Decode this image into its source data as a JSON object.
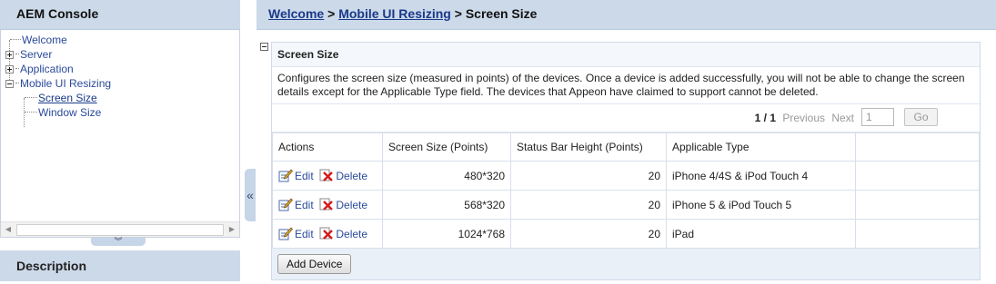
{
  "left_panel": {
    "title": "AEM Console",
    "tree": [
      {
        "label": "Welcome",
        "expander": "none",
        "indent": 0
      },
      {
        "label": "Server",
        "expander": "plus",
        "indent": 0
      },
      {
        "label": "Application",
        "expander": "plus",
        "indent": 0
      },
      {
        "label": "Mobile UI Resizing",
        "expander": "minus",
        "indent": 0
      },
      {
        "label": "Screen Size",
        "expander": "none",
        "indent": 1,
        "selected": true
      },
      {
        "label": "Window Size",
        "expander": "none",
        "indent": 1
      }
    ],
    "collapse_icon": "double-chevron-down-icon",
    "description_title": "Description"
  },
  "splitter": {
    "icon": "double-chevron-left-icon",
    "glyph": "«"
  },
  "breadcrumb": {
    "items": [
      "Welcome",
      "Mobile UI Resizing",
      "Screen Size"
    ],
    "separator": ">"
  },
  "section": {
    "title": "Screen Size",
    "description": "Configures the screen size (measured in points) of the devices. Once a device is added successfully, you will not be able to change the screen details except for the Applicable Type field. The devices that Appeon have claimed to support cannot be deleted.",
    "pager": {
      "info": "1 / 1",
      "prev_label": "Previous",
      "next_label": "Next",
      "page_input_value": "1",
      "go_label": "Go"
    },
    "table": {
      "columns": [
        "Actions",
        "Screen Size (Points)",
        "Status Bar Height (Points)",
        "Applicable Type",
        ""
      ],
      "rows": [
        {
          "edit": "Edit",
          "delete": "Delete",
          "screen_size": "480*320",
          "status_bar": "20",
          "type": "iPhone 4/4S & iPod Touch 4"
        },
        {
          "edit": "Edit",
          "delete": "Delete",
          "screen_size": "568*320",
          "status_bar": "20",
          "type": "iPhone 5 & iPod Touch 5"
        },
        {
          "edit": "Edit",
          "delete": "Delete",
          "screen_size": "1024*768",
          "status_bar": "20",
          "type": "iPad"
        }
      ]
    },
    "add_button": "Add Device"
  },
  "colors": {
    "header_bg": "#ccd9e9",
    "link": "#1a3a8a",
    "box_bg": "#eaf0f8"
  }
}
